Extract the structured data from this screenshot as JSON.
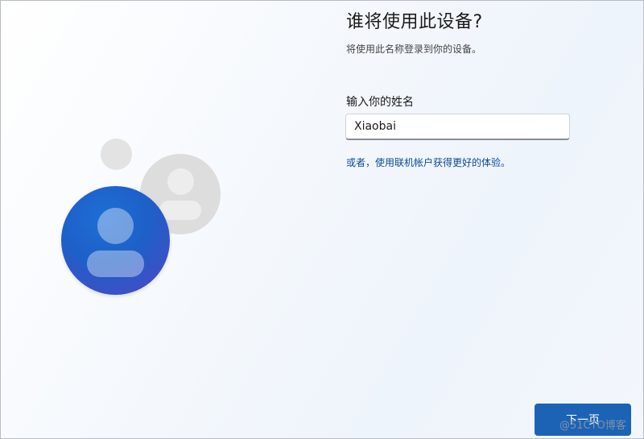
{
  "page": {
    "title": "谁将使用此设备?",
    "subtitle": "将使用此名称登录到你的设备。"
  },
  "form": {
    "name_label": "输入你的姓名",
    "name_value": "Xiaobai",
    "ms_account_link": "或者，使用联机帐户获得更好的体验。"
  },
  "footer": {
    "next_label": "下一页",
    "watermark": "@51CTO博客"
  },
  "illustration": {
    "icons": [
      "user-avatar-icon",
      "secondary-user-avatar-icon",
      "decorative-dot"
    ]
  },
  "colors": {
    "accent": "#1c63b6",
    "link": "#0a4a94",
    "avatar_primary": "#1e5fc8",
    "avatar_secondary": "#dddddd"
  }
}
